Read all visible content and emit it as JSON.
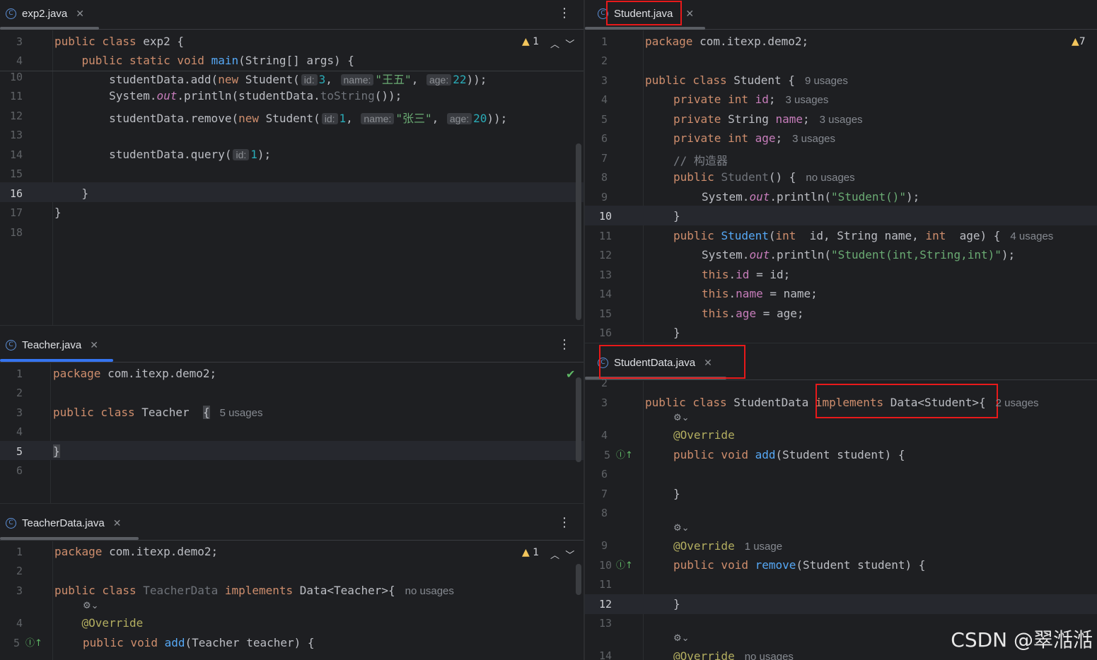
{
  "panes": {
    "exp2": {
      "tab": "exp2.java",
      "warnings": "1"
    },
    "teacher": {
      "tab": "Teacher.java"
    },
    "teacherdata": {
      "tab": "TeacherData.java",
      "warnings": "1"
    },
    "student": {
      "tab": "Student.java",
      "warnings": "7"
    },
    "studentdata": {
      "tab": "StudentData.java"
    }
  },
  "exp2_lines": [
    "3",
    "4",
    "10",
    "11",
    "12",
    "13",
    "14",
    "15",
    "16",
    "17",
    "18"
  ],
  "exp2_code": {
    "l3_a": "public class ",
    "l3_b": "exp2 {",
    "l4_a": "    public static void ",
    "l4_b": "main",
    "l4_c": "(String[] args) {",
    "l10_a": "        studentData.add(",
    "l10_b": "new",
    "l10_c": " Student(",
    "hint_id": "id:",
    "hint_name": "name:",
    "hint_age": "age:",
    "v3": "3",
    "v_wangwu": "\"王五\"",
    "v22": "22",
    "l10_end": "));",
    "l11_a": "        System.",
    "l11_b": "out",
    "l11_c": ".println(studentData.",
    "l11_d": "toString",
    "l11_e": "());",
    "l12_a": "        studentData.remove(",
    "v1": "1",
    "v_zhangsan": "\"张三\"",
    "v20": "20",
    "l14_a": "        studentData.query(",
    "l14_end": ");",
    "close1": "    }",
    "close2": "}",
    "comma": ", "
  },
  "teacher_lines": [
    "1",
    "2",
    "3",
    "4",
    "5",
    "6"
  ],
  "teacher_code": {
    "pkg_kw": "package ",
    "pkg": "com.itexp.demo2;",
    "cls_kw": "public class ",
    "cls": "Teacher  ",
    "brace": "{",
    "usage": "5 usages",
    "close": "}"
  },
  "teacherdata_lines": [
    "1",
    "2",
    "3",
    "4",
    "5"
  ],
  "teacherdata_code": {
    "pkg_kw": "package ",
    "pkg": "com.itexp.demo2;",
    "cls_kw": "public class ",
    "cls": "TeacherData ",
    "impl": "implements ",
    "iface": "Data<Teacher>{",
    "usage": "no usages",
    "override": "@Override",
    "add_kw": "public void ",
    "add": "add",
    "add_args": "(Teacher teacher) {"
  },
  "student_lines": [
    "1",
    "2",
    "3",
    "4",
    "5",
    "6",
    "7",
    "8",
    "9",
    "10",
    "11",
    "12",
    "13",
    "14",
    "15",
    "16"
  ],
  "student_code": {
    "pkg_kw": "package ",
    "pkg": "com.itexp.demo2;",
    "cls_kw": "public class ",
    "cls": "Student {",
    "cls_usage": "9 usages",
    "priv": "private ",
    "int": "int ",
    "string": "String ",
    "f_id": "id",
    "f_name": "name",
    "f_age": "age",
    "semi": ";",
    "u3": "3 usages",
    "comment": "// 构造器",
    "pub": "public ",
    "ctor": "Student",
    "ctor0": "() {",
    "no_usages": "no usages",
    "sys": "System.",
    "out": "out",
    "println": ".println(",
    "s1": "\"Student()\"",
    "s2": "\"Student(int,String,int)\"",
    "end": ");",
    "close": "}",
    "ctor_args_a": "(",
    "ctor_args_b": " id, String name, ",
    "ctor_args_c": " age) {",
    "u4": "4 usages",
    "this": "this",
    "dot": ".",
    "a_id": " = id;",
    "a_name": " = name;",
    "a_age": " = age;"
  },
  "studentdata_lines": [
    "2",
    "3",
    "4",
    "5",
    "6",
    "7",
    "8",
    "9",
    "10",
    "11",
    "12",
    "13",
    "14"
  ],
  "studentdata_code": {
    "cls_kw": "public class ",
    "cls": "StudentData ",
    "impl": "implements ",
    "iface": "Data<Student>{",
    "usage": "2 usages",
    "override": "@Override",
    "u1": "1 usage",
    "no_usages": "no usages",
    "pv": "public void ",
    "add": "add",
    "remove": "remove",
    "args": "(Student student) {",
    "close": "}"
  },
  "watermark": "CSDN @翠湉湉"
}
